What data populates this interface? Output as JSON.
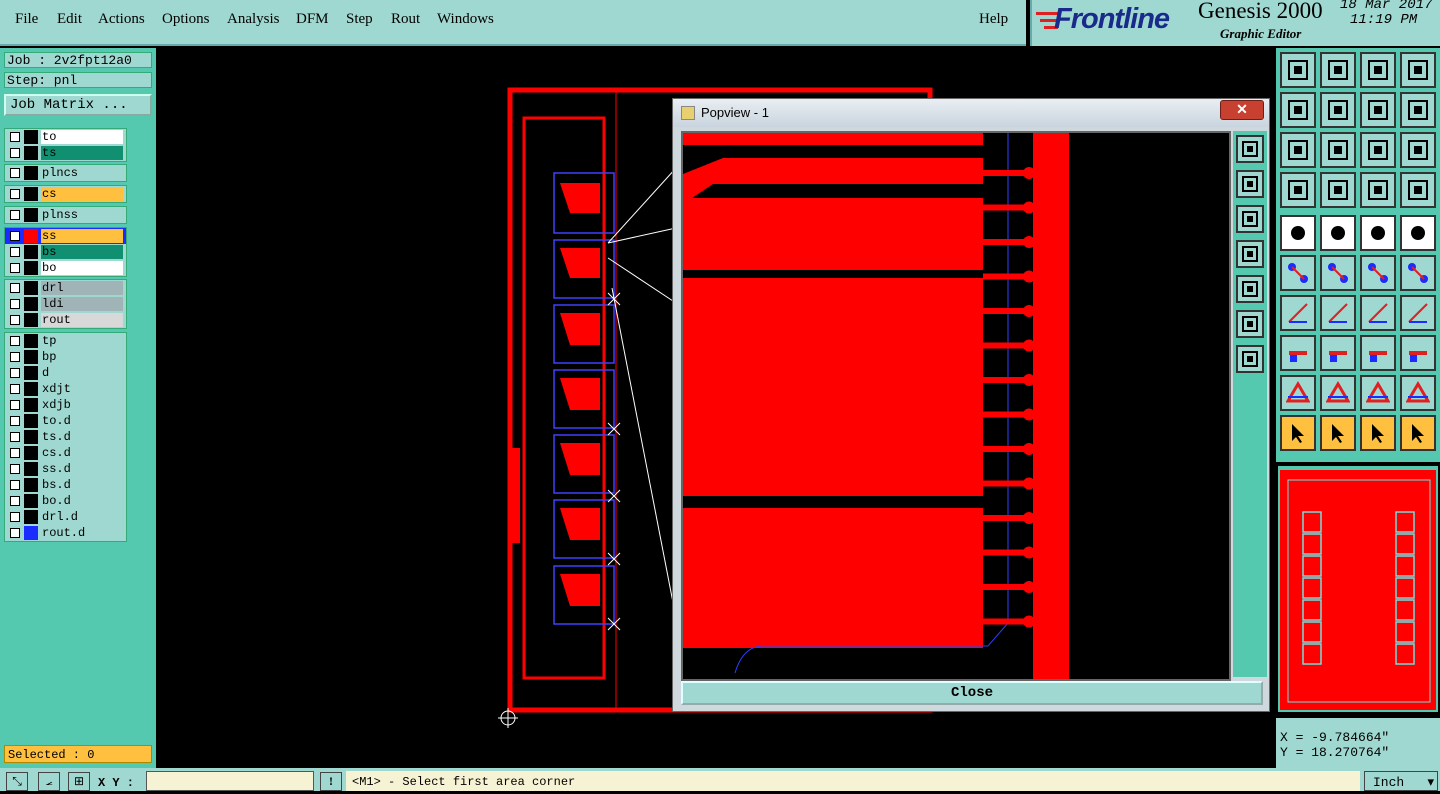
{
  "menu": {
    "items": [
      "File",
      "Edit",
      "Actions",
      "Options",
      "Analysis",
      "DFM",
      "Step",
      "Rout",
      "Windows"
    ],
    "help": "Help"
  },
  "brand": {
    "logo": "Frontline",
    "product": "Genesis 2000",
    "subtitle": "Graphic Editor",
    "date": "18 Mar 2017",
    "time": "11:19 PM"
  },
  "job": {
    "job_label": "Job : 2v2fpt12a0",
    "step_label": "Step: pnl",
    "matrix_button": "Job Matrix ..."
  },
  "layers": [
    {
      "group": 1,
      "name": "to",
      "color": "#000000",
      "bg": "#ffffff"
    },
    {
      "group": 1,
      "name": "ts",
      "color": "#000000",
      "bg": "#109070"
    },
    {
      "group": 2,
      "name": "plncs",
      "color": "#000000",
      "bg": "#9fd8d0"
    },
    {
      "group": 3,
      "name": "cs",
      "color": "#000000",
      "bg": "#ffc040"
    },
    {
      "group": 4,
      "name": "plnss",
      "color": "#000000",
      "bg": "#9fd8d0"
    },
    {
      "group": 5,
      "name": "ss",
      "color": "#ff0000",
      "bg": "#ffc040",
      "active": true
    },
    {
      "group": 5,
      "name": "bs",
      "color": "#000000",
      "bg": "#109070"
    },
    {
      "group": 5,
      "name": "bo",
      "color": "#000000",
      "bg": "#ffffff"
    },
    {
      "group": 6,
      "name": "drl",
      "color": "#000000",
      "bg": "#a0b4b8"
    },
    {
      "group": 6,
      "name": "ldi",
      "color": "#000000",
      "bg": "#a0b4b8"
    },
    {
      "group": 6,
      "name": "rout",
      "color": "#000000",
      "bg": "#d8d8d8"
    },
    {
      "group": 7,
      "name": "tp",
      "color": "#000000",
      "bg": "#9fd8d0"
    },
    {
      "group": 7,
      "name": "bp",
      "color": "#000000",
      "bg": "#9fd8d0"
    },
    {
      "group": 7,
      "name": "d",
      "color": "#000000",
      "bg": "#9fd8d0"
    },
    {
      "group": 7,
      "name": "xdjt",
      "color": "#000000",
      "bg": "#9fd8d0"
    },
    {
      "group": 7,
      "name": "xdjb",
      "color": "#000000",
      "bg": "#9fd8d0"
    },
    {
      "group": 7,
      "name": "to.d",
      "color": "#000000",
      "bg": "#9fd8d0"
    },
    {
      "group": 7,
      "name": "ts.d",
      "color": "#000000",
      "bg": "#9fd8d0"
    },
    {
      "group": 7,
      "name": "cs.d",
      "color": "#000000",
      "bg": "#9fd8d0"
    },
    {
      "group": 7,
      "name": "ss.d",
      "color": "#000000",
      "bg": "#9fd8d0"
    },
    {
      "group": 7,
      "name": "bs.d",
      "color": "#000000",
      "bg": "#9fd8d0"
    },
    {
      "group": 7,
      "name": "bo.d",
      "color": "#000000",
      "bg": "#9fd8d0"
    },
    {
      "group": 7,
      "name": "drl.d",
      "color": "#000000",
      "bg": "#9fd8d0"
    },
    {
      "group": 7,
      "name": "rout.d",
      "color": "#1a2cff",
      "bg": "#9fd8d0"
    }
  ],
  "selected": "Selected : 0",
  "popview": {
    "title": "Popview - 1",
    "close_label": "Close"
  },
  "coords": {
    "x": "X = -9.784664\"",
    "y": "Y = 18.270764\""
  },
  "statusbar": {
    "xy_label": "X Y :",
    "xy_value": "",
    "message": "<M1> - Select first area corner",
    "units": "Inch"
  },
  "toolbar_icons": [
    "home-icon",
    "window-icon",
    "zoom-home-icon",
    "split-view-icon",
    "pan-left-icon",
    "pan-right-icon",
    "redraw-icon",
    "swap-icon",
    "zoom-fit-icon",
    "zoom-center-icon",
    "one-to-two-icon",
    "help-icon",
    "tools-icon",
    "grid-icon",
    "layers-1-icon",
    "layers-2-icon",
    "select-icon",
    "color-icon",
    "ruler-icon",
    "pad-icon",
    "connect-icon",
    "cut-icon",
    "move-icon",
    "move-2-icon",
    "angle-icon",
    "line-icon",
    "arc-icon",
    "text-icon",
    "copy-icon",
    "stretch-icon",
    "measure-icon",
    "shapes-icon",
    "mark-1-icon",
    "mark-2-icon",
    "mark-3-icon",
    "mark-4-icon",
    "pointer-icon",
    "pointer-box-icon",
    "pointer-circle-icon",
    "pointer-net-icon"
  ],
  "popview_icons": [
    "pv-home-icon",
    "pv-up-icon",
    "pv-down-icon",
    "pv-left-icon",
    "pv-right-icon",
    "pv-fit-icon",
    "pv-zoom-icon"
  ]
}
